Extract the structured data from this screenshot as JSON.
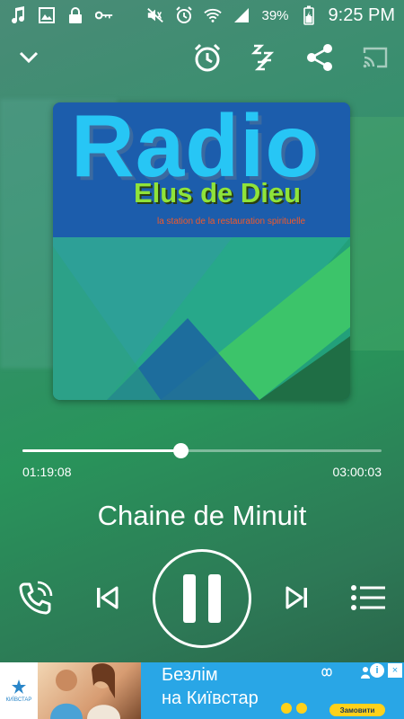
{
  "status_bar": {
    "battery": "39%",
    "time": "9:25 PM",
    "left_icons": [
      "music-note-icon",
      "image-icon",
      "lock-icon",
      "key-icon"
    ],
    "right_icons": [
      "mute-icon",
      "alarm-icon",
      "wifi-icon",
      "signal-icon",
      "battery-icon"
    ]
  },
  "toolbar": {
    "icons": [
      "chevron-down-icon",
      "alarm-clock-icon",
      "sleep-timer-icon",
      "share-icon",
      "cast-icon"
    ]
  },
  "album_art": {
    "title": "Radio",
    "subtitle": "Elus de Dieu",
    "tagline": "la station de la restauration spirituelle"
  },
  "player": {
    "current_time": "01:19:08",
    "total_time": "03:00:03",
    "progress_fraction": 0.44,
    "track_title": "Chaine de Minuit",
    "state": "playing"
  },
  "controls": [
    "call-icon",
    "previous-icon",
    "pause-icon",
    "next-icon",
    "playlist-icon"
  ],
  "ad": {
    "brand_small": "КИЇВСТАР",
    "line1": "Безлім",
    "line2": "на Київстар",
    "cta": "Замовити",
    "info": "i",
    "close": "×"
  },
  "colors": {
    "accent": "#ffffff",
    "ad_background": "#29a6e6",
    "ad_cta": "#ffd11a"
  }
}
